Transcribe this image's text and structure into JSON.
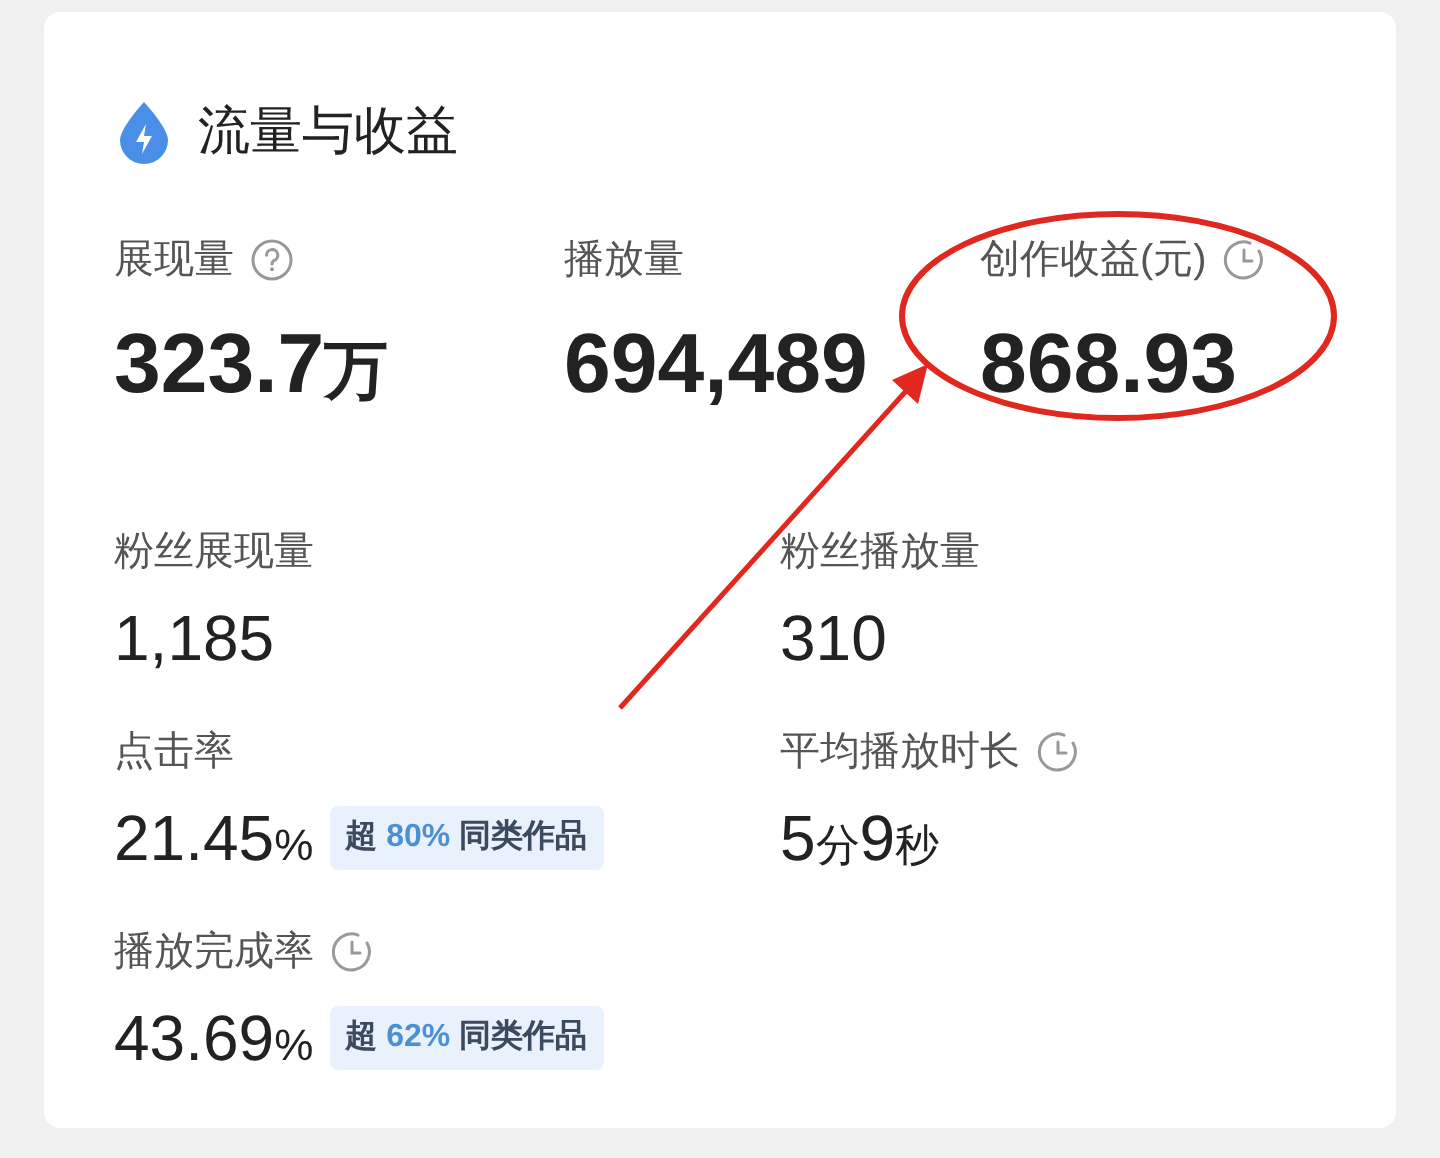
{
  "card": {
    "title": "流量与收益"
  },
  "top_metrics": [
    {
      "label": "展现量",
      "kind": "help",
      "value": [
        {
          "text": "323.7",
          "kind": "number"
        },
        {
          "text": "万",
          "kind": "unit"
        }
      ]
    },
    {
      "label": "播放量",
      "kind": "plain",
      "value": [
        {
          "text": "694,489",
          "kind": "number"
        }
      ]
    },
    {
      "label": "创作收益(元)",
      "kind": "timed",
      "value": [
        {
          "text": "868.93",
          "kind": "number"
        }
      ]
    }
  ],
  "metrics": [
    {
      "label": "粉丝展现量",
      "kind": "plain",
      "value": [
        {
          "text": "1,185",
          "kind": "number"
        }
      ]
    },
    {
      "label": "粉丝播放量",
      "kind": "plain",
      "value": [
        {
          "text": "310",
          "kind": "number"
        }
      ]
    },
    {
      "label": "点击率",
      "kind": "plain",
      "value": [
        {
          "text": "21.45",
          "kind": "number"
        },
        {
          "text": "%",
          "kind": "unit"
        }
      ],
      "badge": {
        "prefix": "超",
        "highlight": "80%",
        "suffix": "同类作品"
      }
    },
    {
      "label": "平均播放时长",
      "kind": "timed",
      "value": [
        {
          "text": "5",
          "kind": "number"
        },
        {
          "text": "分",
          "kind": "unit"
        },
        {
          "text": "9",
          "kind": "number"
        },
        {
          "text": "秒",
          "kind": "unit"
        }
      ]
    },
    {
      "label": "播放完成率",
      "kind": "timed",
      "value": [
        {
          "text": "43.69",
          "kind": "number"
        },
        {
          "text": "%",
          "kind": "unit"
        }
      ],
      "badge": {
        "prefix": "超",
        "highlight": "62%",
        "suffix": "同类作品"
      }
    }
  ]
}
